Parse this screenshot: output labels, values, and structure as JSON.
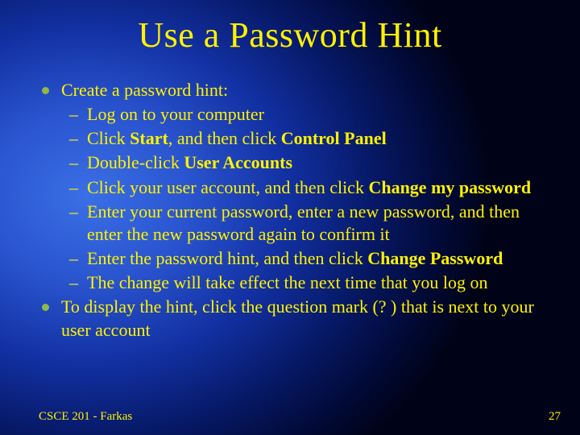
{
  "title": "Use a Password Hint",
  "bullets": {
    "b1": "Create a password hint:",
    "s1": "Log on to your computer",
    "s2a": "Click ",
    "s2b": "Start",
    "s2c": ", and then click ",
    "s2d": "Control Panel",
    "s3a": "Double-click ",
    "s3b": "User Accounts",
    "s4a": "Click your user account, and then click ",
    "s4b": "Change my password",
    "s5": "Enter your current password, enter a new password, and then enter the new password again to confirm it",
    "s6a": "Enter the password hint, and then click ",
    "s6b": "Change Password",
    "s7": "The change will take effect the next time that you log on",
    "b2": "To display the hint, click the question mark (? ) that is next to your user account"
  },
  "footer": {
    "left": "CSCE 201 - Farkas",
    "right": "27"
  }
}
